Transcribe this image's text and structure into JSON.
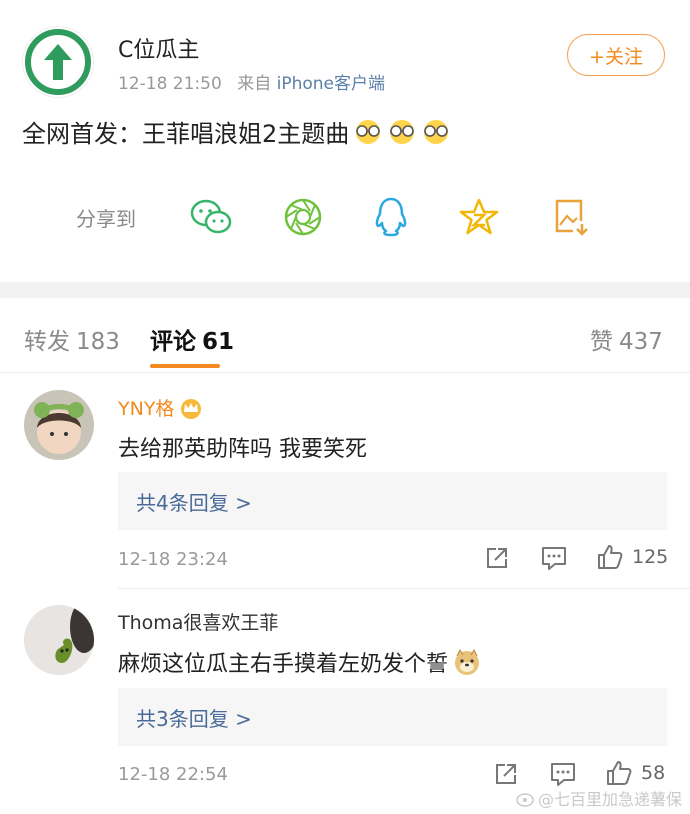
{
  "post": {
    "author": "C位瓜主",
    "time": "12-18 21:50",
    "source_prefix": "来自",
    "source_device": "iPhone客户端",
    "follow_label": "+关注",
    "text": "全网首发：王菲唱浪姐2主题曲"
  },
  "share": {
    "label": "分享到",
    "icons": [
      "wechat-icon",
      "moments-icon",
      "qq-icon",
      "qzone-icon",
      "save-image-icon"
    ]
  },
  "tabs": {
    "repost_label": "转发",
    "repost_count": "183",
    "comment_label": "评论",
    "comment_count": "61",
    "like_label": "赞",
    "like_count": "437"
  },
  "comments": [
    {
      "name": "YNY格",
      "name_color": "#f28a1f",
      "text": "去给那英助阵吗 我要笑死",
      "replies": "共4条回复 >",
      "time": "12-18 23:24",
      "likes": "125"
    },
    {
      "name": "Thoma很喜欢王菲",
      "name_color": "#333333",
      "text": "麻烦这位瓜主右手摸着左奶发个誓",
      "replies": "共3条回复 >",
      "time": "12-18 22:54",
      "likes": "58"
    }
  ],
  "watermark": "@七百里加急递薯保",
  "colors": {
    "accent": "#f28a1f",
    "link": "#4a6a98",
    "band": "#f2f2f2"
  }
}
